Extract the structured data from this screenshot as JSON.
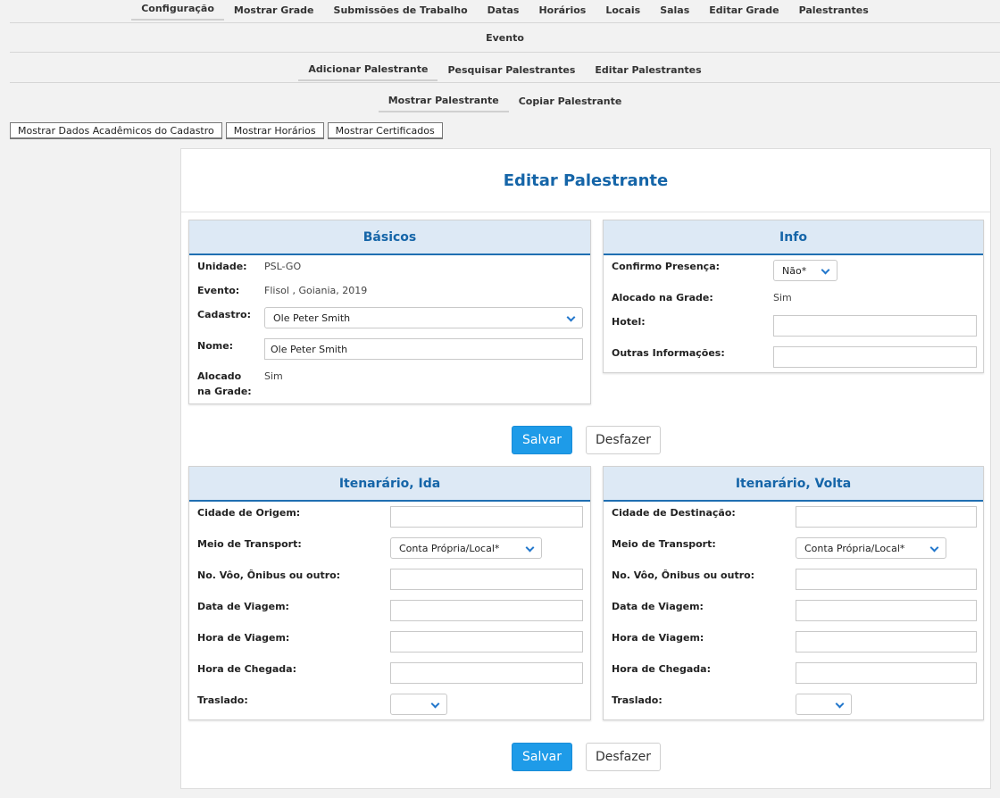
{
  "nav": {
    "main": [
      "Configuração",
      "Mostrar Grade",
      "Submissões de Trabalho",
      "Datas",
      "Horários",
      "Locais",
      "Salas",
      "Editar Grade",
      "Palestrantes"
    ],
    "event": "Evento",
    "speakers": [
      "Adicionar Palestrante",
      "Pesquisar Palestrantes",
      "Editar Palestrantes"
    ],
    "speaker_sub": [
      "Mostrar Palestrante",
      "Copiar Palestrante"
    ]
  },
  "actions": {
    "academic": "Mostrar Dados Acadêmicos do Cadastro",
    "schedules": "Mostrar Horários",
    "certificates": "Mostrar Certificados"
  },
  "page_title": "Editar Palestrante",
  "basics": {
    "title": "Básicos",
    "unidade_label": "Unidade:",
    "unidade_value": "PSL-GO",
    "evento_label": "Evento:",
    "evento_value": "Flisol , Goiania, 2019",
    "cadastro_label": "Cadastro:",
    "cadastro_value": "Ole Peter Smith",
    "nome_label": "Nome:",
    "nome_value": "Ole Peter Smith",
    "alocado_label_1": "Alocado",
    "alocado_label_2": "na Grade:",
    "alocado_value": "Sim"
  },
  "info": {
    "title": "Info",
    "confirmo_label": "Confirmo Presença:",
    "confirmo_value": "Não*",
    "alocado_label": "Alocado na Grade:",
    "alocado_value": "Sim",
    "hotel_label": "Hotel:",
    "hotel_value": "",
    "outras_label": "Outras Informações:",
    "outras_value": ""
  },
  "buttons": {
    "save": "Salvar",
    "undo": "Desfazer"
  },
  "outbound": {
    "title": "Itenarário, Ida",
    "cidade_label": "Cidade de Origem:",
    "meio_label": "Meio de Transport:",
    "meio_value": "Conta Própria/Local*",
    "voo_label": "No. Vôo, Ônibus ou outro:",
    "data_label": "Data de Viagem:",
    "hora_label": "Hora de Viagem:",
    "chegada_label": "Hora de Chegada:",
    "traslado_label": "Traslado:",
    "traslado_value": ""
  },
  "return": {
    "title": "Itenarário, Volta",
    "cidade_label": "Cidade de Destinação:",
    "meio_label": "Meio de Transport:",
    "meio_value": "Conta Própria/Local*",
    "voo_label": "No. Vôo, Ônibus ou outro:",
    "data_label": "Data de Viagem:",
    "hora_label": "Hora de Viagem:",
    "chegada_label": "Hora de Chegada:",
    "traslado_label": "Traslado:",
    "traslado_value": ""
  },
  "colors": {
    "accent": "#1565a8",
    "primary_button": "#1e9be8",
    "card_header": "#dde9f5"
  }
}
